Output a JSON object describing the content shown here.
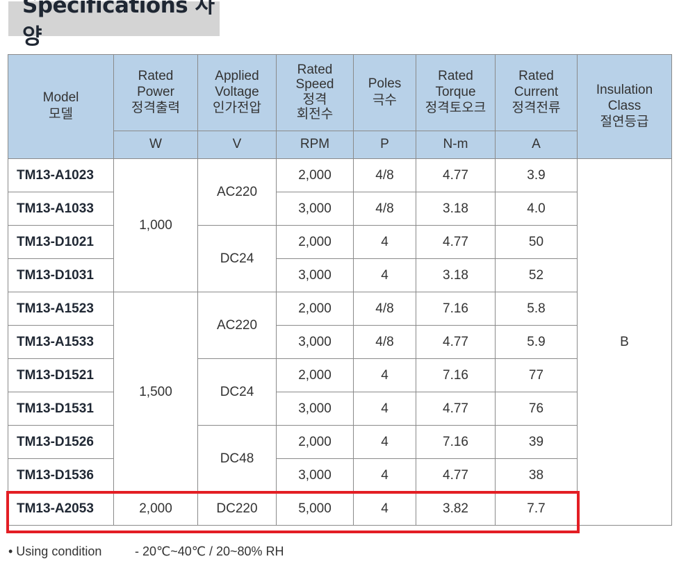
{
  "title": "Specifications 사양",
  "headers": {
    "model": [
      "Model",
      "모델"
    ],
    "power": [
      "Rated",
      "Power",
      "정격출력"
    ],
    "voltage": [
      "Applied",
      "Voltage",
      "인가전압"
    ],
    "speed": [
      "Rated",
      "Speed",
      "정격",
      "회전수"
    ],
    "poles": [
      "Poles",
      "극수"
    ],
    "torque": [
      "Rated",
      "Torque",
      "정격토오크"
    ],
    "current": [
      "Rated",
      "Current",
      "정격전류"
    ],
    "insulation": [
      "Insulation",
      "Class",
      "절연등급"
    ]
  },
  "units": {
    "power": "W",
    "voltage": "V",
    "speed": "RPM",
    "poles": "P",
    "torque": "N-m",
    "current": "A"
  },
  "rows": [
    {
      "model": "TM13-A1023",
      "speed": "2,000",
      "poles": "4/8",
      "torque": "4.77",
      "current": "3.9"
    },
    {
      "model": "TM13-A1033",
      "speed": "3,000",
      "poles": "4/8",
      "torque": "3.18",
      "current": "4.0"
    },
    {
      "model": "TM13-D1021",
      "speed": "2,000",
      "poles": "4",
      "torque": "4.77",
      "current": "50"
    },
    {
      "model": "TM13-D1031",
      "speed": "3,000",
      "poles": "4",
      "torque": "3.18",
      "current": "52"
    },
    {
      "model": "TM13-A1523",
      "speed": "2,000",
      "poles": "4/8",
      "torque": "7.16",
      "current": "5.8"
    },
    {
      "model": "TM13-A1533",
      "speed": "3,000",
      "poles": "4/8",
      "torque": "4.77",
      "current": "5.9"
    },
    {
      "model": "TM13-D1521",
      "speed": "2,000",
      "poles": "4",
      "torque": "7.16",
      "current": "77"
    },
    {
      "model": "TM13-D1531",
      "speed": "3,000",
      "poles": "4",
      "torque": "4.77",
      "current": "76"
    },
    {
      "model": "TM13-D1526",
      "speed": "2,000",
      "poles": "4",
      "torque": "7.16",
      "current": "39"
    },
    {
      "model": "TM13-D1536",
      "speed": "3,000",
      "poles": "4",
      "torque": "4.77",
      "current": "38"
    },
    {
      "model": "TM13-A2053",
      "power": "2,000",
      "voltage": "DC220",
      "speed": "5,000",
      "poles": "4",
      "torque": "3.82",
      "current": "7.7"
    }
  ],
  "groups": {
    "power": [
      "1,000",
      "1,500"
    ],
    "voltage": [
      "AC220",
      "DC24",
      "AC220",
      "DC24",
      "DC48"
    ]
  },
  "insulation_class": "B",
  "highlight_color": "#e31e24",
  "header_bg": "#b8d1e8",
  "note": {
    "label": "• Using condition",
    "value": "- 20℃~40℃ / 20~80% RH"
  }
}
